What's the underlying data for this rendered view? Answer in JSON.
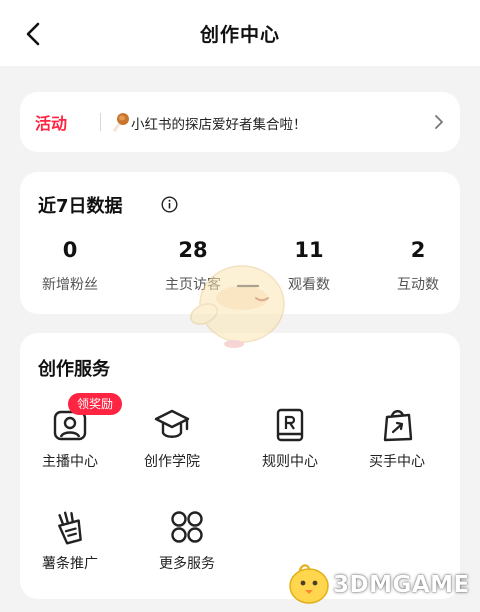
{
  "header": {
    "title": "创作中心"
  },
  "banner": {
    "tag": "活动",
    "text": "小红书的探店爱好者集合啦！"
  },
  "stats": {
    "title": "近7日数据",
    "items": [
      {
        "value": "0",
        "label": "新增粉丝"
      },
      {
        "value": "28",
        "label": "主页访客"
      },
      {
        "value": "11",
        "label": "观看数"
      },
      {
        "value": "2",
        "label": "互动数"
      }
    ]
  },
  "services": {
    "title": "创作服务",
    "badge": "领奖励",
    "items": [
      {
        "label": "主播中心",
        "icon": "host-center-icon"
      },
      {
        "label": "创作学院",
        "icon": "graduation-cap-icon"
      },
      {
        "label": "规则中心",
        "icon": "rules-book-icon"
      },
      {
        "label": "买手中心",
        "icon": "shopping-bag-icon"
      },
      {
        "label": "薯条推广",
        "icon": "fries-promo-icon"
      },
      {
        "label": "更多服务",
        "icon": "more-grid-icon"
      }
    ]
  },
  "watermark": {
    "text": "3DMGAME"
  },
  "colors": {
    "accent": "#ff2442",
    "background": "#f3f3f3",
    "card": "#ffffff"
  }
}
